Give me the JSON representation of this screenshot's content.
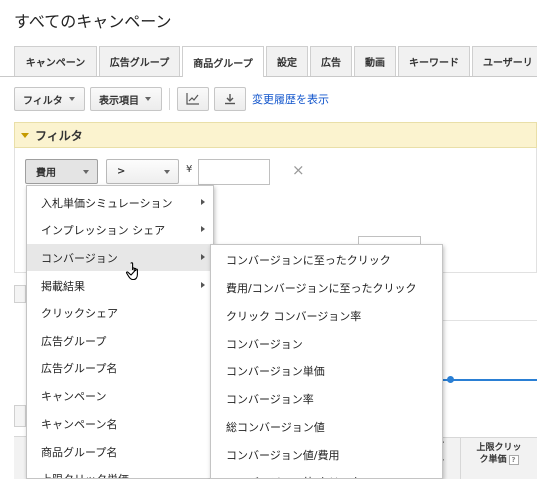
{
  "page": {
    "title": "すべてのキャンペーン"
  },
  "tabs": [
    {
      "label": "キャンペーン",
      "active": false
    },
    {
      "label": "広告グループ",
      "active": false
    },
    {
      "label": "商品グループ",
      "active": true
    },
    {
      "label": "設定",
      "active": false
    },
    {
      "label": "広告",
      "active": false
    },
    {
      "label": "動画",
      "active": false
    },
    {
      "label": "キーワード",
      "active": false
    },
    {
      "label": "ユーザーリ",
      "active": false
    }
  ],
  "toolbar": {
    "filter_label": "フィルタ",
    "columns_label": "表示項目",
    "chart_icon": "line-chart-icon",
    "download_icon": "download-icon",
    "history_link": "変更履歴を表示"
  },
  "filter_panel": {
    "title": "フィルタ",
    "metric_value": "費用",
    "operator_value": ">",
    "currency_symbol": "¥",
    "value_text": "",
    "clear_glyph": "×"
  },
  "metric_menu": {
    "items": [
      {
        "label": "入札単価シミュレーション",
        "has_submenu": true
      },
      {
        "label": "インプレッション シェア",
        "has_submenu": true
      },
      {
        "label": "コンバージョン",
        "has_submenu": true,
        "highlighted": true
      },
      {
        "label": "掲載結果",
        "has_submenu": true
      },
      {
        "label": "クリックシェア",
        "has_submenu": false
      },
      {
        "label": "広告グループ",
        "has_submenu": false
      },
      {
        "label": "広告グループ名",
        "has_submenu": false
      },
      {
        "label": "キャンペーン",
        "has_submenu": false
      },
      {
        "label": "キャンペーン名",
        "has_submenu": false
      },
      {
        "label": "商品グループ名",
        "has_submenu": false
      },
      {
        "label": "上限クリック単価",
        "has_submenu": false
      }
    ]
  },
  "conversion_submenu": {
    "items": [
      "コンバージョンに至ったクリック",
      "費用/コンバージョンに至ったクリック",
      "クリック コンバージョン率",
      "コンバージョン",
      "コンバージョン単価",
      "コンバージョン率",
      "総コンバージョン値",
      "コンバージョン値/費用",
      "コンバージョン値/クリック"
    ]
  },
  "table": {
    "col_partial": "グ\n単",
    "col_maxcpc_line1": "上限クリッ",
    "col_maxcpc_line2": "ク単価",
    "help_glyph": "?"
  },
  "colors": {
    "link": "#1155cc",
    "filter_bg": "#fbf3cf",
    "chart_line": "#2a7fd4",
    "menu_hover": "#e7e7e7"
  }
}
